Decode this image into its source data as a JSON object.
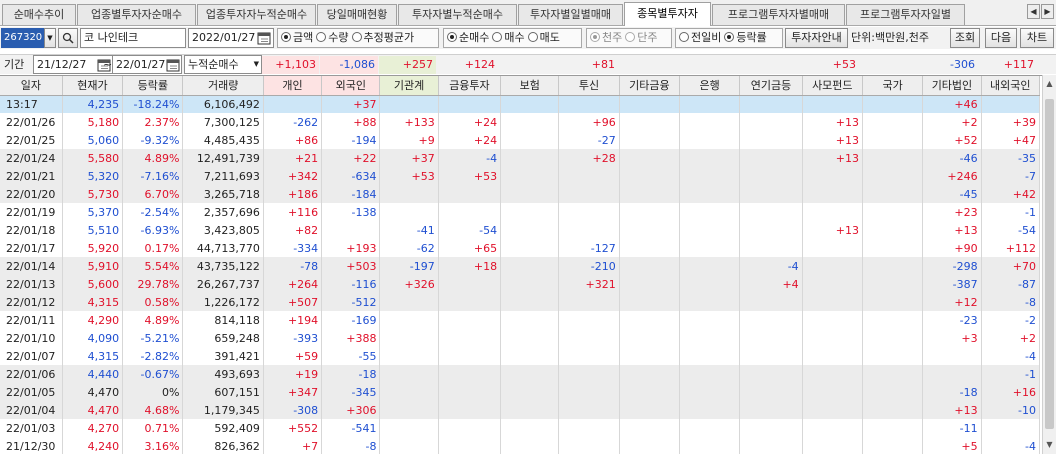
{
  "tabs": [
    {
      "label": "순매수추이",
      "active": false
    },
    {
      "label": "업종별투자자순매수",
      "active": false
    },
    {
      "label": "업종투자자누적순매수",
      "active": false
    },
    {
      "label": "당일매매현황",
      "active": false
    },
    {
      "label": "투자자별누적순매수",
      "active": false
    },
    {
      "label": "투자자별일별매매",
      "active": false
    },
    {
      "label": "종목별투자자",
      "active": true
    },
    {
      "label": "프로그램투자자별매매",
      "active": false
    },
    {
      "label": "프로그램투자자일별",
      "active": false
    }
  ],
  "toolbar": {
    "code": "267320",
    "stock_prefix": "코",
    "stock_name": "나인테크",
    "date": "2022/01/27",
    "mode_options": [
      "금액",
      "수량",
      "추정평균가"
    ],
    "mode_selected": "금액",
    "trade_options": [
      "순매수",
      "매수",
      "매도"
    ],
    "trade_selected": "순매수",
    "unit_options": [
      "천주",
      "단주"
    ],
    "unit_selected": "천주",
    "compare_options": [
      "전일비",
      "등락률"
    ],
    "compare_selected": "등락률",
    "guide_button": "투자자안내",
    "unit_text": "단위:백만원,천주",
    "query_button": "조회",
    "next_button": "다음",
    "chart_button": "차트"
  },
  "period": {
    "label": "기간",
    "from": "21/12/27",
    "tilde": "~",
    "to": "22/01/27",
    "type": "누적순매수",
    "summary": {
      "individual": "+1,103",
      "foreign": "-1,086",
      "institution": "+257",
      "financial": "+124",
      "insurance": "",
      "trust": "+81",
      "other_fin": "",
      "bank": "",
      "pension": "",
      "private_fund": "+53",
      "nation": "",
      "other_corp": "-306",
      "domestic_foreign": "+117"
    }
  },
  "columns": [
    "일자",
    "현재가",
    "등락률",
    "거래량",
    "개인",
    "외국인",
    "기관계",
    "금융투자",
    "보험",
    "투신",
    "기타금융",
    "은행",
    "연기금등",
    "사모펀드",
    "국가",
    "기타법인",
    "내외국인"
  ],
  "rows": [
    [
      "13:17",
      "4,235",
      "-18.24%",
      "6,106,492",
      "",
      "+37",
      "",
      "",
      "",
      "",
      "",
      "",
      "",
      "",
      "",
      "+46",
      ""
    ],
    [
      "22/01/26",
      "5,180",
      "2.37%",
      "7,300,125",
      "-262",
      "+88",
      "+133",
      "+24",
      "",
      "+96",
      "",
      "",
      "",
      "+13",
      "",
      "+2",
      "+39"
    ],
    [
      "22/01/25",
      "5,060",
      "-9.32%",
      "4,485,435",
      "+86",
      "-194",
      "+9",
      "+24",
      "",
      "-27",
      "",
      "",
      "",
      "+13",
      "",
      "+52",
      "+47"
    ],
    [
      "22/01/24",
      "5,580",
      "4.89%",
      "12,491,739",
      "+21",
      "+22",
      "+37",
      "-4",
      "",
      "+28",
      "",
      "",
      "",
      "+13",
      "",
      "-46",
      "-35"
    ],
    [
      "22/01/21",
      "5,320",
      "-7.16%",
      "7,211,693",
      "+342",
      "-634",
      "+53",
      "+53",
      "",
      "",
      "",
      "",
      "",
      "",
      "",
      "+246",
      "-7"
    ],
    [
      "22/01/20",
      "5,730",
      "6.70%",
      "3,265,718",
      "+186",
      "-184",
      "",
      "",
      "",
      "",
      "",
      "",
      "",
      "",
      "",
      "-45",
      "+42"
    ],
    [
      "22/01/19",
      "5,370",
      "-2.54%",
      "2,357,696",
      "+116",
      "-138",
      "",
      "",
      "",
      "",
      "",
      "",
      "",
      "",
      "",
      "+23",
      "-1"
    ],
    [
      "22/01/18",
      "5,510",
      "-6.93%",
      "3,423,805",
      "+82",
      "",
      "-41",
      "-54",
      "",
      "",
      "",
      "",
      "",
      "+13",
      "",
      "+13",
      "-54"
    ],
    [
      "22/01/17",
      "5,920",
      "0.17%",
      "44,713,770",
      "-334",
      "+193",
      "-62",
      "+65",
      "",
      "-127",
      "",
      "",
      "",
      "",
      "",
      "+90",
      "+112"
    ],
    [
      "22/01/14",
      "5,910",
      "5.54%",
      "43,735,122",
      "-78",
      "+503",
      "-197",
      "+18",
      "",
      "-210",
      "",
      "",
      "-4",
      "",
      "",
      "-298",
      "+70"
    ],
    [
      "22/01/13",
      "5,600",
      "29.78%",
      "26,267,737",
      "+264",
      "-116",
      "+326",
      "",
      "",
      "+321",
      "",
      "",
      "+4",
      "",
      "",
      "-387",
      "-87"
    ],
    [
      "22/01/12",
      "4,315",
      "0.58%",
      "1,226,172",
      "+507",
      "-512",
      "",
      "",
      "",
      "",
      "",
      "",
      "",
      "",
      "",
      "+12",
      "-8"
    ],
    [
      "22/01/11",
      "4,290",
      "4.89%",
      "814,118",
      "+194",
      "-169",
      "",
      "",
      "",
      "",
      "",
      "",
      "",
      "",
      "",
      "-23",
      "-2"
    ],
    [
      "22/01/10",
      "4,090",
      "-5.21%",
      "659,248",
      "-393",
      "+388",
      "",
      "",
      "",
      "",
      "",
      "",
      "",
      "",
      "",
      "+3",
      "+2"
    ],
    [
      "22/01/07",
      "4,315",
      "-2.82%",
      "391,421",
      "+59",
      "-55",
      "",
      "",
      "",
      "",
      "",
      "",
      "",
      "",
      "",
      "",
      "-4"
    ],
    [
      "22/01/06",
      "4,440",
      "-0.67%",
      "493,693",
      "+19",
      "-18",
      "",
      "",
      "",
      "",
      "",
      "",
      "",
      "",
      "",
      "",
      "-1"
    ],
    [
      "22/01/05",
      "4,470",
      "0%",
      "607,151",
      "+347",
      "-345",
      "",
      "",
      "",
      "",
      "",
      "",
      "",
      "",
      "",
      "-18",
      "+16"
    ],
    [
      "22/01/04",
      "4,470",
      "4.68%",
      "1,179,345",
      "-308",
      "+306",
      "",
      "",
      "",
      "",
      "",
      "",
      "",
      "",
      "",
      "+13",
      "-10"
    ],
    [
      "22/01/03",
      "4,270",
      "0.71%",
      "592,409",
      "+552",
      "-541",
      "",
      "",
      "",
      "",
      "",
      "",
      "",
      "",
      "",
      "-11",
      ""
    ],
    [
      "21/12/30",
      "4,240",
      "3.16%",
      "826,362",
      "+7",
      "-8",
      "",
      "",
      "",
      "",
      "",
      "",
      "",
      "",
      "",
      "+5",
      "-4"
    ]
  ],
  "colors": {
    "up": "#e0102a",
    "down": "#1f4fd1",
    "row_alt": "#ececec",
    "row_selected": "#cde6f7",
    "header_individual": "#fde3e3",
    "header_foreign": "#fde3e3",
    "header_institution": "#e8f0d6"
  }
}
